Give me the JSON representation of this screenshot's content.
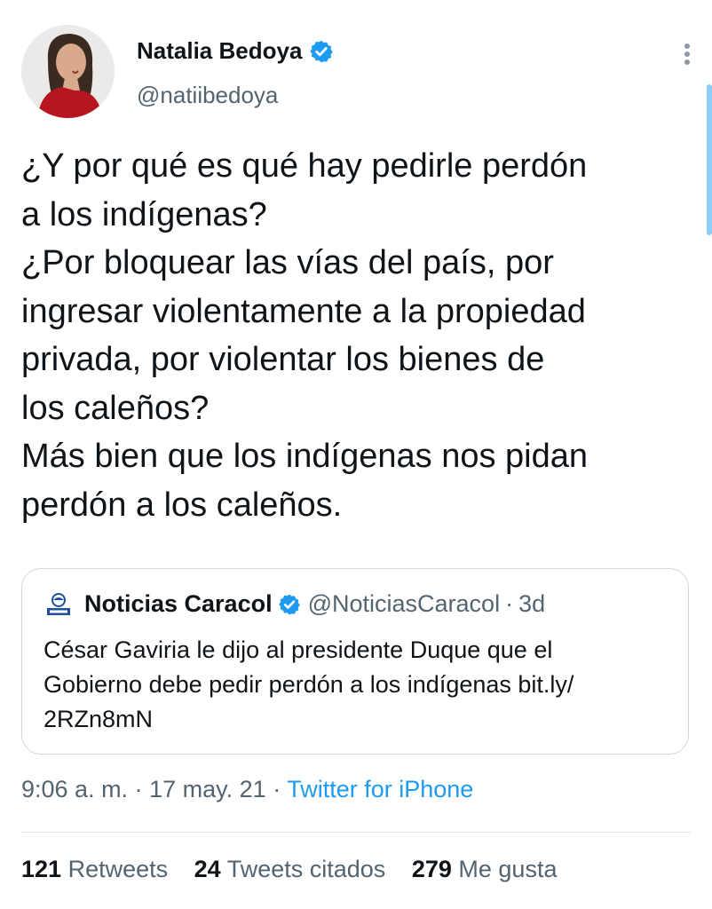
{
  "author": {
    "name": "Natalia Bedoya",
    "handle": "@natiibedoya"
  },
  "tweet": {
    "lines": [
      "¿Y por qué es qué hay pedirle perdón",
      "a los indígenas?",
      "¿Por bloquear las vías del país, por",
      "ingresar violentamente a la propiedad",
      "privada, por violentar los bienes de",
      "los caleños?",
      "Más bien que los indígenas nos pidan",
      "perdón a los caleños."
    ]
  },
  "quoted": {
    "name": "Noticias Caracol",
    "handle": "@NoticiasCaracol",
    "separator": "·",
    "time": "3d",
    "lines": [
      "César Gaviria le dijo al presidente Duque que el",
      "Gobierno debe pedir perdón a los indígenas bit.ly/",
      "2RZn8mN"
    ]
  },
  "meta": {
    "time": "9:06 a. m.",
    "separator": "·",
    "date": "17 may. 21",
    "source": "Twitter for iPhone"
  },
  "stats": {
    "retweets_count": "121",
    "retweets_label": "Retweets",
    "quotes_count": "24",
    "quotes_label": "Tweets citados",
    "likes_count": "279",
    "likes_label": "Me gusta"
  },
  "colors": {
    "verified": "#1d9bf0",
    "link": "#1d9bf0",
    "secondary_text": "#536471",
    "avatar_dress": "#b5161f"
  },
  "icons": {
    "verified": "verified-badge-icon",
    "more": "more-options-icon",
    "news_logo": "noticias-caracol-logo"
  }
}
